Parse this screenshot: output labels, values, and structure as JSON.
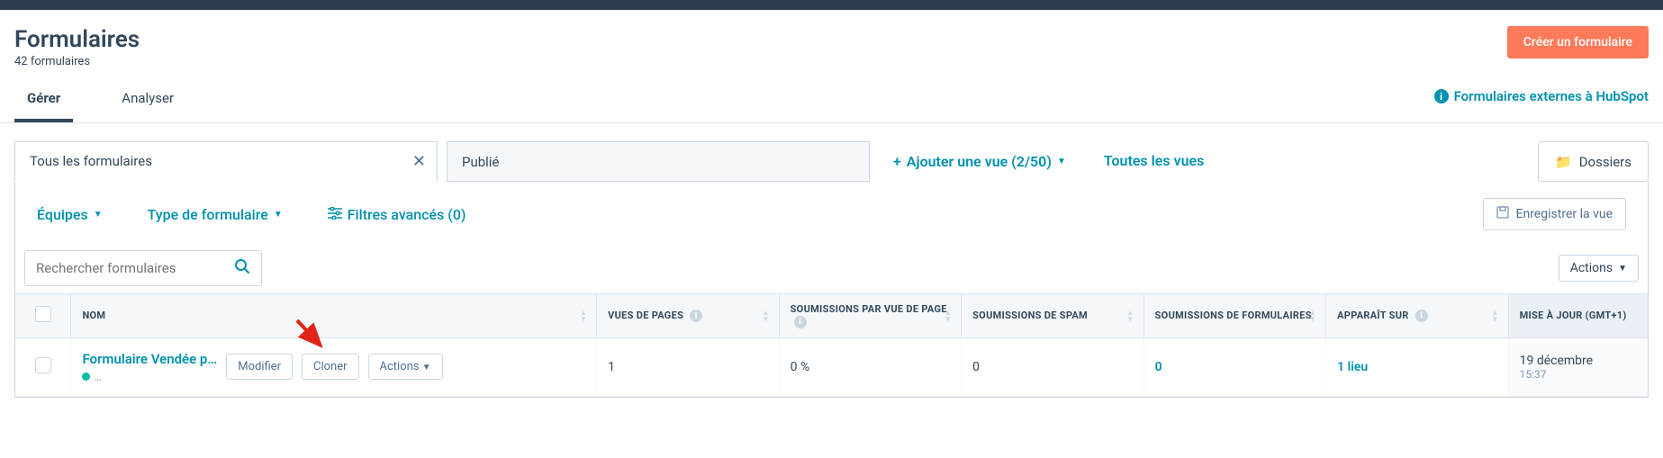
{
  "header": {
    "title": "Formulaires",
    "subtitle": "42 formulaires",
    "create_button": "Créer un formulaire"
  },
  "tabs": {
    "manage": "Gérer",
    "analyze": "Analyser",
    "external_link": "Formulaires externes à HubSpot"
  },
  "views": {
    "tab1": "Tous les formulaires",
    "tab2": "Publié",
    "add_view": "Ajouter une vue (2/50)",
    "all_views": "Toutes les vues",
    "folders": "Dossiers"
  },
  "filters": {
    "teams": "Équipes",
    "form_type": "Type de formulaire",
    "advanced": "Filtres avancés (0)",
    "save_view": "Enregistrer la vue"
  },
  "search": {
    "placeholder": "Rechercher formulaires",
    "actions": "Actions"
  },
  "columns": {
    "name": "NOM",
    "page_views": "VUES DE PAGES",
    "sub_per_view": "SOUMISSIONS PAR VUE DE PAGE",
    "spam": "SOUMISSIONS DE SPAM",
    "form_sub": "SOUMISSIONS DE FORMULAIRES",
    "appears_on": "APPARAÎT SUR",
    "updated": "MISE À JOUR (GMT+1)"
  },
  "rows": [
    {
      "name": "Formulaire Vendée p…",
      "status_text": "…",
      "modify": "Modifier",
      "clone": "Cloner",
      "actions": "Actions",
      "page_views": "1",
      "sub_per_view": "0 %",
      "spam": "0",
      "form_sub": "0",
      "appears_on": "1 lieu",
      "updated_date": "19 décembre",
      "updated_time": "15:37"
    }
  ]
}
